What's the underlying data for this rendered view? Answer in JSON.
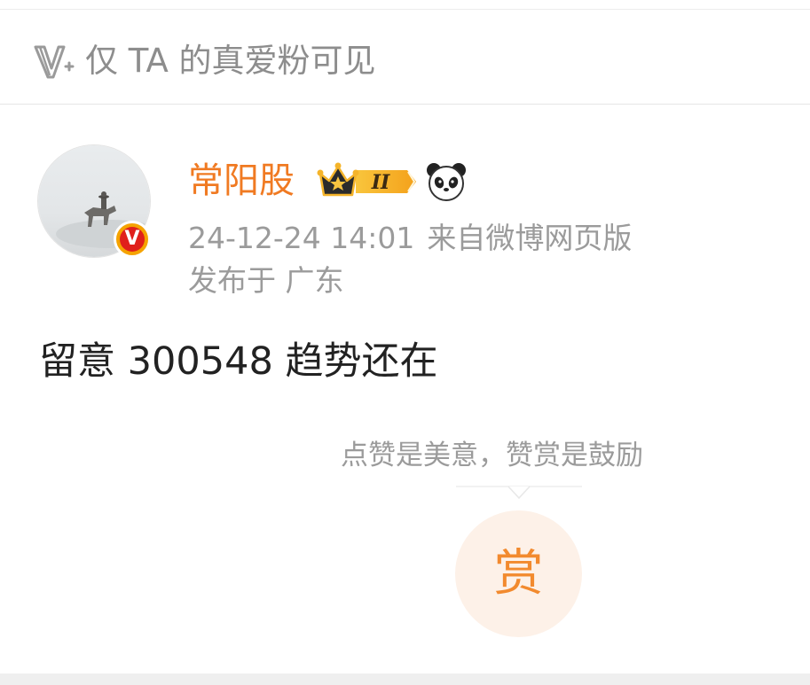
{
  "visibility": {
    "icon": "v-plus-icon",
    "text": "仅 TA 的真爱粉可见"
  },
  "author": {
    "name": "常阳股",
    "verified_badge": "V",
    "membership_level": "II",
    "emoji_icon": "panda-icon"
  },
  "meta": {
    "timestamp": "24-12-24 14:01",
    "source": "来自微博网页版",
    "location": "发布于 广东"
  },
  "post": {
    "text": "留意 300548 趋势还在"
  },
  "reward": {
    "tip": "点赞是美意，赞赏是鼓励",
    "button_label": "赏"
  },
  "colors": {
    "username": "#f07a22",
    "meta_gray": "#9b9b9b",
    "reward_bg": "#fdf1e8",
    "reward_text": "#f28a2e",
    "verified_red": "#e0201b",
    "verified_ring": "#f5a300"
  }
}
